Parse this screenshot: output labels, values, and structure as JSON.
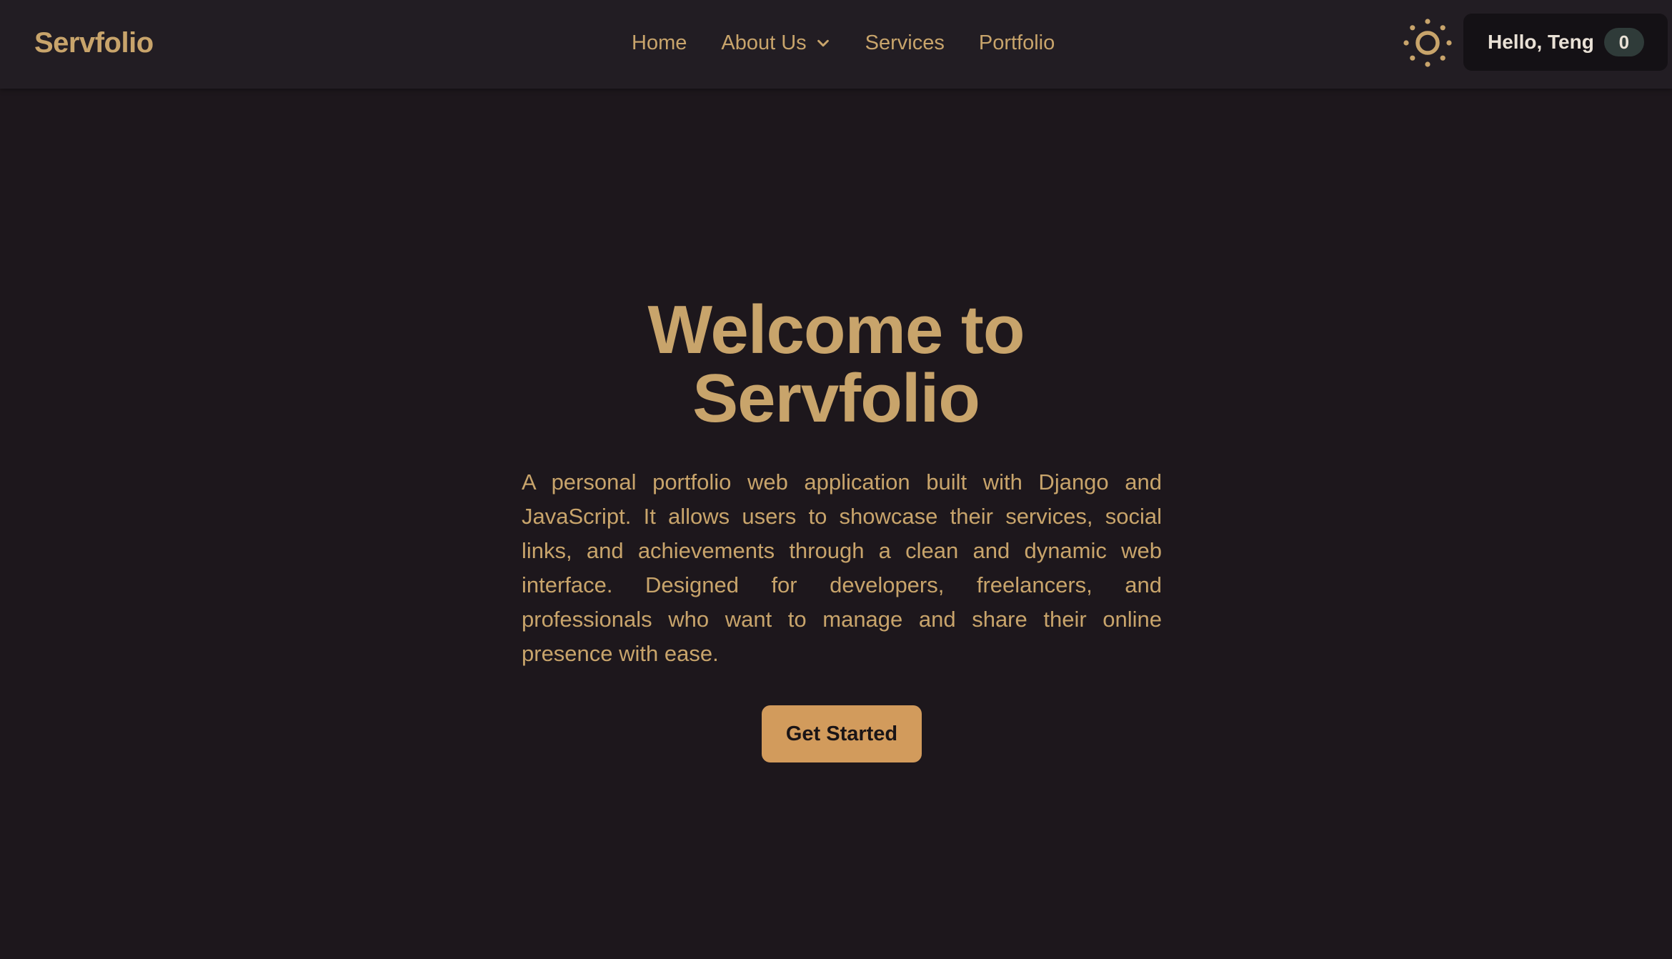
{
  "brand": {
    "name": "Servfolio"
  },
  "nav": {
    "items": [
      {
        "label": "Home"
      },
      {
        "label": "About Us",
        "has_dropdown": true
      },
      {
        "label": "Services"
      },
      {
        "label": "Portfolio"
      }
    ]
  },
  "header": {
    "theme_icon": "sun-icon",
    "user_greeting": "Hello, Teng",
    "user_badge": "0"
  },
  "hero": {
    "title_line1": "Welcome to",
    "title_line2": "Servfolio",
    "description": "A personal portfolio web application built with Django and JavaScript. It allows users to showcase their services, social links, and achievements through a clean and dynamic web interface. Designed for developers, freelancers, and professionals who want to manage and share their online presence with ease.",
    "cta_label": "Get Started"
  },
  "colors": {
    "background": "#1d171c",
    "navbar": "#221d23",
    "accent": "#c8a46b",
    "button": "#d29b5c",
    "pill": "#141115",
    "badge": "#2f3b39"
  }
}
